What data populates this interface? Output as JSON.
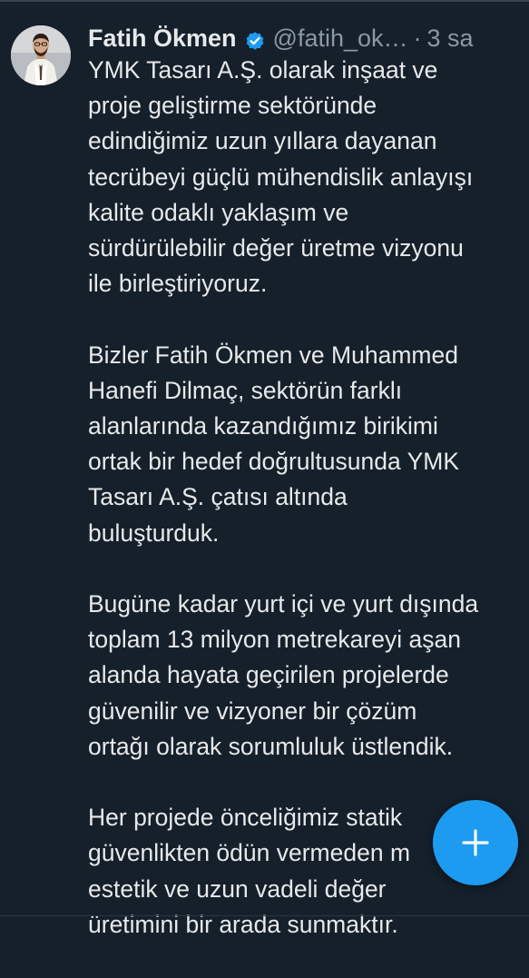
{
  "tweet": {
    "author": {
      "display_name": "Fatih Ökmen",
      "handle": "@fatih_ok…",
      "separator": "·",
      "time": "3 sa",
      "verified_icon": "verified-badge-icon",
      "avatar_icon": "avatar"
    },
    "paragraphs": [
      {
        "lines": [
          "YMK Tasarı A.Ş. olarak inşaat ve",
          "proje geliştirme sektöründe",
          "edindiğimiz uzun yıllara dayanan",
          "tecrübeyi güçlü mühendislik anlayışı",
          "kalite odaklı yaklaşım ve",
          "sürdürülebilir değer üretme vizyonu",
          "ile birleştiriyoruz."
        ]
      },
      {
        "lines": [
          "Bizler Fatih Ökmen ve Muhammed",
          "Hanefi Dilmaç, sektörün farklı",
          "alanlarında kazandığımız birikimi",
          "ortak bir hedef doğrultusunda YMK",
          "Tasarı A.Ş. çatısı altında",
          "buluşturduk."
        ]
      },
      {
        "lines": [
          "Bugüne kadar yurt içi ve yurt dışında",
          "toplam 13 milyon metrekareyi aşan",
          "alanda hayata geçirilen projelerde",
          "güvenilir ve vizyoner bir çözüm",
          "ortağı olarak sorumluluk üstlendik."
        ]
      },
      {
        "lines": [
          "Her projede önceliğimiz statik",
          "güvenlikten ödün vermeden m",
          "estetik ve uzun vadeli değer",
          "üretimini bir arada sunmaktır."
        ]
      }
    ]
  },
  "compose_button": {
    "icon": "plus-icon",
    "color": "#1d9bf0"
  },
  "colors": {
    "background": "#15202b",
    "text": "#e7e9ea",
    "secondary_text": "#8b98a5",
    "verified": "#1d9bf0"
  }
}
